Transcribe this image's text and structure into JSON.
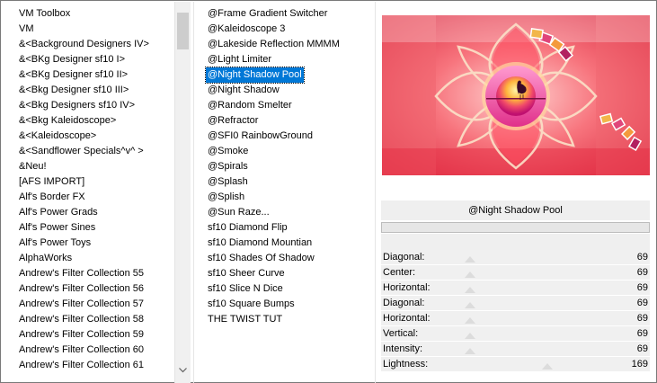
{
  "categories": [
    "VM Toolbox",
    "VM",
    "&<Background Designers IV>",
    "&<BKg Designer sf10 I>",
    "&<BKg Designer sf10 II>",
    "&<Bkg Designer sf10 III>",
    "&<Bkg Designers sf10 IV>",
    "&<Bkg Kaleidoscope>",
    "&<Kaleidoscope>",
    "&<Sandflower Specials^v^ >",
    "&Neu!",
    "[AFS IMPORT]",
    "Alf's Border FX",
    "Alf's Power Grads",
    "Alf's Power Sines",
    "Alf's Power Toys",
    "AlphaWorks",
    "Andrew's Filter Collection 55",
    "Andrew's Filter Collection 56",
    "Andrew's Filter Collection 57",
    "Andrew's Filter Collection 58",
    "Andrew's Filter Collection 59",
    "Andrew's Filter Collection 60",
    "Andrew's Filter Collection 61"
  ],
  "filters": [
    "@Frame Gradient Switcher",
    "@Kaleidoscope 3",
    "@Lakeside Reflection MMMM",
    "@Light Limiter",
    "@Night Shadow Pool",
    "@Night Shadow",
    "@Random Smelter",
    "@Refractor",
    "@SFI0 RainbowGround",
    "@Smoke",
    "@Spirals",
    "@Splash",
    "@Splish",
    "@Sun Raze...",
    "sf10 Diamond Flip",
    "sf10 Diamond Mountian",
    "sf10 Shades Of Shadow",
    "sf10 Sheer Curve",
    "sf10 Slice N Dice",
    "sf10 Square Bumps",
    "THE TWIST TUT"
  ],
  "selected_filter": "@Night Shadow Pool",
  "filter_name": "@Night Shadow Pool",
  "sliders": [
    {
      "label": "Diagonal:",
      "value": "69",
      "level": 69
    },
    {
      "label": "Center:",
      "value": "69",
      "level": 69
    },
    {
      "label": "Horizontal:",
      "value": "69",
      "level": 69
    },
    {
      "label": "Diagonal:",
      "value": "69",
      "level": 69
    },
    {
      "label": "Horizontal:",
      "value": "69",
      "level": 69
    },
    {
      "label": "Vertical:",
      "value": "69",
      "level": 69
    },
    {
      "label": "Intensity:",
      "value": "69",
      "level": 69
    },
    {
      "label": "Lightness:",
      "value": "169",
      "level": 169
    }
  ],
  "icons": {
    "scroll_down": "chevron-down-icon"
  },
  "colors": {
    "selection": "#0078d7",
    "preview_accent": "#e33a4a"
  }
}
